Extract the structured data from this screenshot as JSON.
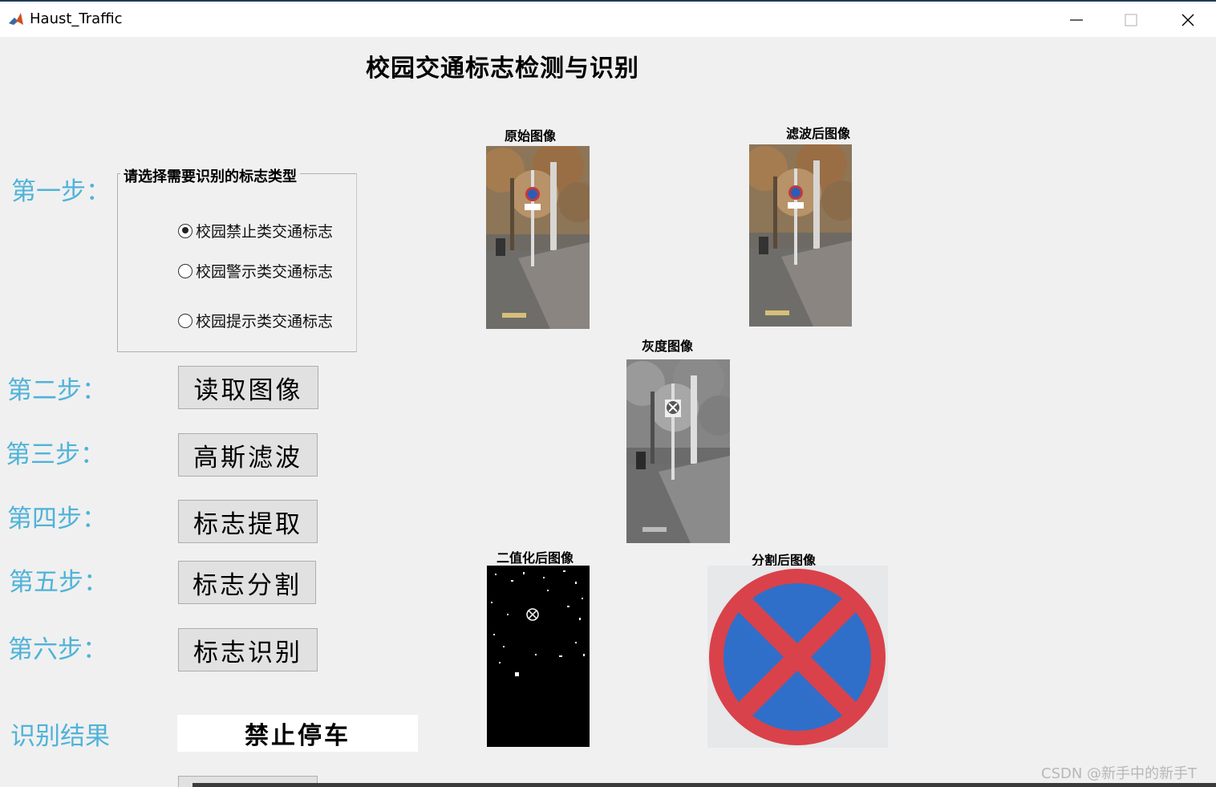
{
  "window": {
    "title": "Haust_Traffic",
    "icon": "matlab-icon",
    "controls": [
      "minimize-icon",
      "maximize-icon",
      "close-icon"
    ]
  },
  "main_title": "校园交通标志检测与识别",
  "steps": {
    "step1": "第一步：",
    "step2": "第二步：",
    "step3": "第三步：",
    "step4": "第四步：",
    "step5": "第五步：",
    "step6": "第六步："
  },
  "sign_type_panel": {
    "title": "请选择需要识别的标志类型",
    "options": [
      {
        "label": "校园禁止类交通标志",
        "selected": true
      },
      {
        "label": "校园警示类交通标志",
        "selected": false
      },
      {
        "label": "校园提示类交通标志",
        "selected": false
      }
    ]
  },
  "buttons": {
    "read_image": "读取图像",
    "gaussian_filter": "高斯滤波",
    "sign_extract": "标志提取",
    "sign_segment": "标志分割",
    "sign_recognize": "标志识别"
  },
  "result": {
    "label": "识别结果",
    "value": "禁止停车"
  },
  "images": {
    "original": "原始图像",
    "filtered": "滤波后图像",
    "gray": "灰度图像",
    "binary": "二值化后图像",
    "segmented": "分割后图像"
  },
  "colors": {
    "step_label": "#4fb3d9",
    "sign_red": "#d9424a",
    "sign_blue": "#2f6fc9"
  },
  "watermark": "CSDN @新手中的新手T"
}
